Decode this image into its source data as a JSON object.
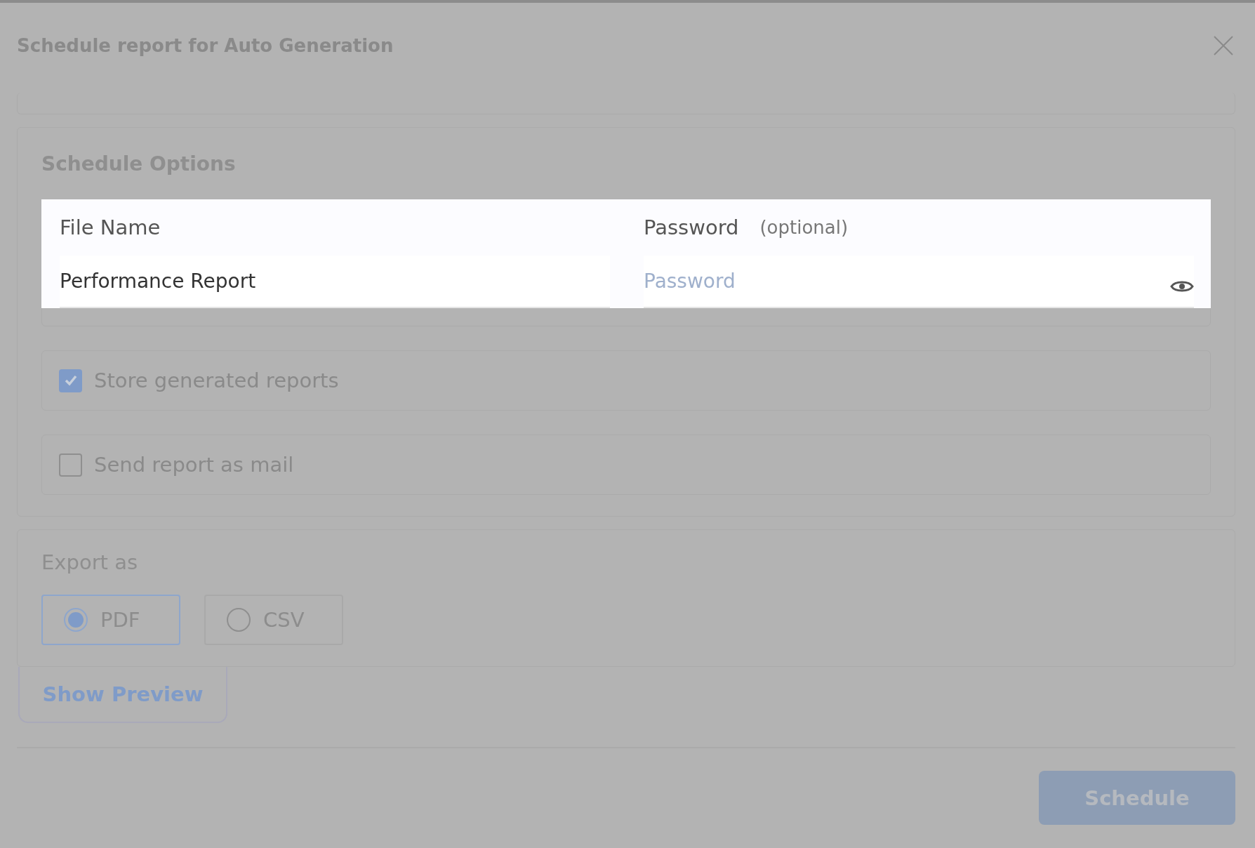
{
  "dialog": {
    "title": "Schedule report for Auto Generation"
  },
  "schedule_options": {
    "heading": "Schedule Options",
    "file_name": {
      "label": "File Name",
      "value": "Performance Report"
    },
    "password": {
      "label": "Password",
      "hint": "(optional)",
      "placeholder": "Password"
    },
    "options": [
      {
        "label": "Store generated reports",
        "checked": true
      },
      {
        "label": "Send report as mail",
        "checked": false
      }
    ]
  },
  "export": {
    "heading": "Export as",
    "formats": [
      {
        "label": "PDF",
        "selected": true
      },
      {
        "label": "CSV",
        "selected": false
      }
    ]
  },
  "preview_button": "Show Preview",
  "schedule_button": "Schedule"
}
